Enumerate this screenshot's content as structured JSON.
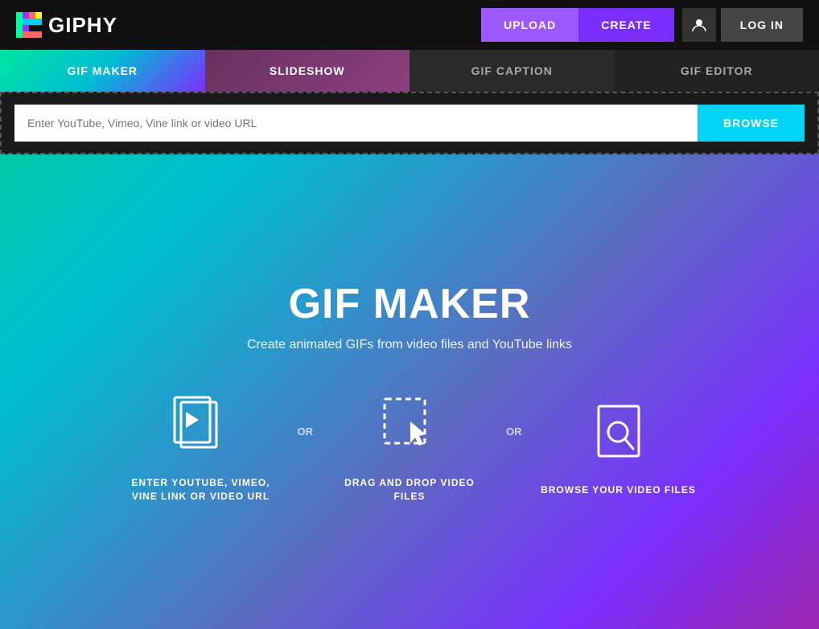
{
  "header": {
    "logo_text": "GIPHY",
    "upload_label": "UPLOAD",
    "create_label": "CREATE",
    "login_label": "LOG IN"
  },
  "tabs": {
    "gif_maker": "GIF MAKER",
    "slideshow": "SLIDESHOW",
    "gif_caption": "GIF CAPTION",
    "gif_editor": "GIF EDITOR",
    "active": "gif_maker"
  },
  "upload_area": {
    "placeholder": "Enter YouTube, Vimeo, Vine link or video URL",
    "browse_label": "BROWSE"
  },
  "main": {
    "title": "GIF MAKER",
    "subtitle": "Create animated GIFs from video files and YouTube links",
    "icon1_label": "ENTER YOUTUBE, VIMEO, VINE LINK OR VIDEO URL",
    "icon2_label": "DRAG AND DROP VIDEO FILES",
    "icon3_label": "BROWSE YOUR VIDEO FILES",
    "or1": "OR",
    "or2": "OR"
  },
  "colors": {
    "upload_btn": "#9b59ff",
    "create_btn": "#7b2fff",
    "browse_btn": "#00d4f5",
    "tab_active_start": "#00e5a0",
    "tab_active_end": "#7b2fff"
  }
}
